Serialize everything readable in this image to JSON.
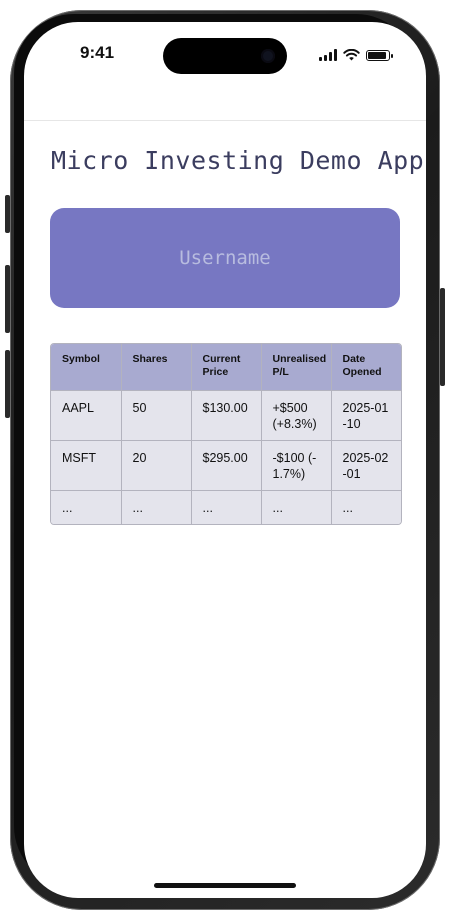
{
  "status_bar": {
    "time": "9:41"
  },
  "app": {
    "title": "Micro Investing Demo App",
    "username_placeholder": "Username"
  },
  "table": {
    "headers": [
      "Symbol",
      "Shares",
      "Current Price",
      "Unrealised P/L",
      "Date Opened"
    ],
    "rows": [
      [
        "AAPL",
        "50",
        "$130.00",
        "+$500 (+8.3%)",
        "2025-01-10"
      ],
      [
        "MSFT",
        "20",
        "$295.00",
        "-$100 (-1.7%)",
        "2025-02-01"
      ],
      [
        "...",
        "...",
        "...",
        "...",
        "..."
      ]
    ]
  },
  "colors": {
    "accent": "#7777c2",
    "table_header": "#a8aad0",
    "table_cell": "#e4e4ec",
    "title_text": "#3b3d5f"
  }
}
